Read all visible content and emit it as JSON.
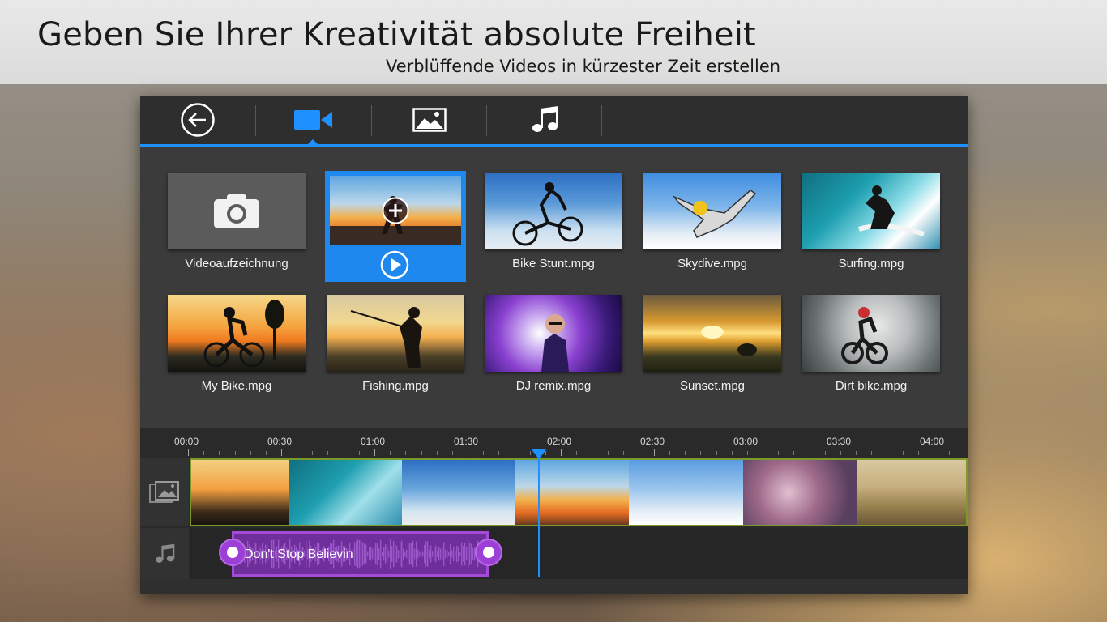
{
  "banner": {
    "title": "Geben Sie Ihrer Kreativität absolute Freiheit",
    "subtitle": "Verblüffende Videos in kürzester Zeit erstellen"
  },
  "toolbar": {
    "tabs": [
      {
        "icon": "back-arrow-icon"
      },
      {
        "icon": "video-camera-icon",
        "active": true
      },
      {
        "icon": "image-icon"
      },
      {
        "icon": "music-note-icon"
      }
    ],
    "accent_color": "#1e90ff"
  },
  "library": {
    "items": [
      {
        "label": "Videoaufzeichnung",
        "icon": "camera-icon"
      },
      {
        "label": "",
        "selected": true,
        "icons": [
          "add-icon",
          "play-icon"
        ]
      },
      {
        "label": "Bike Stunt.mpg"
      },
      {
        "label": "Skydive.mpg"
      },
      {
        "label": "Surfing.mpg"
      },
      {
        "label": "My Bike.mpg"
      },
      {
        "label": "Fishing.mpg"
      },
      {
        "label": "DJ remix.mpg"
      },
      {
        "label": "Sunset.mpg"
      },
      {
        "label": "Dirt bike.mpg"
      }
    ]
  },
  "timeline": {
    "ticks": [
      "00:00",
      "00:30",
      "01:00",
      "01:30",
      "02:00",
      "02:30",
      "03:00",
      "03:30",
      "04:00"
    ],
    "video_track_icon": "film-image-icon",
    "audio_track_icon": "music-note-icon",
    "audio_clip_label": "Don't Stop Believin",
    "audio_color": "#a44ad6",
    "video_track_border": "#7c9a2a"
  }
}
